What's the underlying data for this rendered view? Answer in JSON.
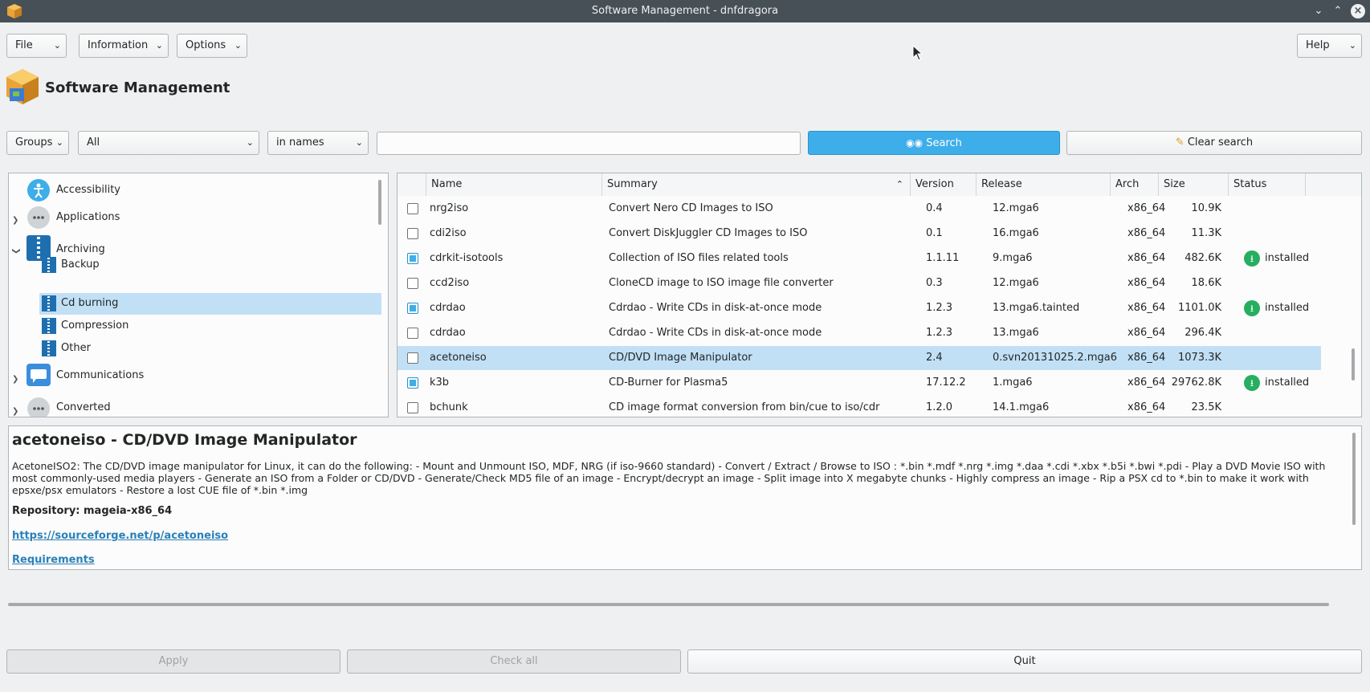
{
  "window": {
    "title": "Software Management - dnfdragora"
  },
  "menubar": {
    "file": "File",
    "information": "Information",
    "options": "Options",
    "help": "Help"
  },
  "header": {
    "title": "Software Management"
  },
  "filters": {
    "view": "Groups",
    "filter": "All",
    "search_in": "in names",
    "search_value": "",
    "search_label": "Search",
    "clear_label": "Clear search"
  },
  "tree": {
    "items": [
      {
        "label": "Accessibility"
      },
      {
        "label": "Applications"
      },
      {
        "label": "Archiving"
      },
      {
        "label": "Backup"
      },
      {
        "label": "Cd burning"
      },
      {
        "label": "Compression"
      },
      {
        "label": "Other"
      },
      {
        "label": "Communications"
      },
      {
        "label": "Converted"
      }
    ]
  },
  "table": {
    "headers": {
      "name": "Name",
      "summary": "Summary",
      "version": "Version",
      "release": "Release",
      "arch": "Arch",
      "size": "Size",
      "status": "Status"
    },
    "rows": [
      {
        "name": "nrg2iso",
        "summary": "Convert Nero CD Images to ISO",
        "version": "0.4",
        "release": "12.mga6",
        "arch": "x86_64",
        "size": "10.9K",
        "status": ""
      },
      {
        "name": "cdi2iso",
        "summary": "Convert DiskJuggler CD Images to ISO",
        "version": "0.1",
        "release": "16.mga6",
        "arch": "x86_64",
        "size": "11.3K",
        "status": ""
      },
      {
        "name": "cdrkit-isotools",
        "summary": "Collection of ISO files related tools",
        "version": "1.1.11",
        "release": "9.mga6",
        "arch": "x86_64",
        "size": "482.6K",
        "status": "installed"
      },
      {
        "name": "ccd2iso",
        "summary": "CloneCD image to ISO image file converter",
        "version": "0.3",
        "release": "12.mga6",
        "arch": "x86_64",
        "size": "18.6K",
        "status": ""
      },
      {
        "name": "cdrdao",
        "summary": "Cdrdao - Write CDs in disk-at-once mode",
        "version": "1.2.3",
        "release": "13.mga6.tainted",
        "arch": "x86_64",
        "size": "1101.0K",
        "status": "installed"
      },
      {
        "name": "cdrdao",
        "summary": "Cdrdao - Write CDs in disk-at-once mode",
        "version": "1.2.3",
        "release": "13.mga6",
        "arch": "x86_64",
        "size": "296.4K",
        "status": ""
      },
      {
        "name": "acetoneiso",
        "summary": "CD/DVD Image Manipulator",
        "version": "2.4",
        "release": "0.svn20131025.2.mga6",
        "arch": "x86_64",
        "size": "1073.3K",
        "status": ""
      },
      {
        "name": "k3b",
        "summary": "CD-Burner for Plasma5",
        "version": "17.12.2",
        "release": "1.mga6",
        "arch": "x86_64",
        "size": "29762.8K",
        "status": "installed"
      },
      {
        "name": "bchunk",
        "summary": "CD image format conversion from bin/cue to iso/cdr",
        "version": "1.2.0",
        "release": "14.1.mga6",
        "arch": "x86_64",
        "size": "23.5K",
        "status": ""
      }
    ]
  },
  "details": {
    "title": "acetoneiso - CD/DVD Image Manipulator",
    "body": "AcetoneISO2: The CD/DVD image manipulator for Linux, it can do the following: - Mount and Unmount ISO, MDF, NRG (if iso-9660 standard) - Convert / Extract / Browse to ISO : *.bin *.mdf *.nrg *.img *.daa *.cdi *.xbx *.b5i *.bwi *.pdi - Play a DVD Movie ISO with most commonly-used media players - Generate an ISO from a Folder or CD/DVD - Generate/Check MD5 file of an image - Encrypt/decrypt an image - Split image into X megabyte chunks - Highly compress an image - Rip a PSX cd to *.bin to make it work with epsxe/psx emulators - Restore a lost CUE file of *.bin *.img",
    "repository": "Repository: mageia-x86_64",
    "url": "https://sourceforge.net/p/acetoneiso",
    "requirements": "Requirements"
  },
  "footer": {
    "apply": "Apply",
    "check_all": "Check all",
    "quit": "Quit"
  },
  "colors": {
    "accent": "#3daee9",
    "selection": "#c2e0f5",
    "titlebar": "#475057",
    "installed": "#27ae60"
  }
}
